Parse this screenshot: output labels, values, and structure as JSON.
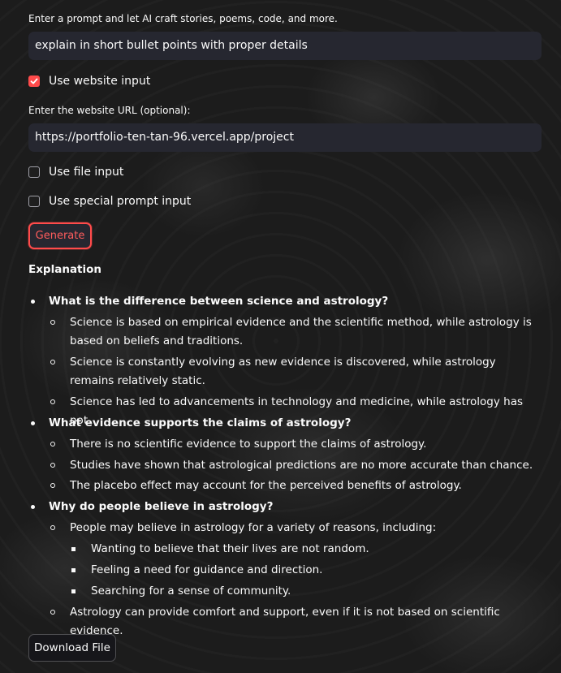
{
  "prompt": {
    "label": "Enter a prompt and let AI craft stories, poems, code, and more.",
    "value": "explain in short bullet points with proper details"
  },
  "website_checkbox": {
    "label": "Use website input",
    "checked": true
  },
  "url": {
    "label": "Enter the website URL (optional):",
    "value": "https://portfolio-ten-tan-96.vercel.app/project"
  },
  "file_checkbox": {
    "label": "Use file input",
    "checked": false
  },
  "special_checkbox": {
    "label": "Use special prompt input",
    "checked": false
  },
  "generate_label": "Generate",
  "explanation": {
    "title": "Explanation",
    "sections": [
      {
        "heading": "What is the difference between science and astrology?",
        "points": [
          "Science is based on empirical evidence and the scientific method, while astrology is based on beliefs and traditions.",
          "Science is constantly evolving as new evidence is discovered, while astrology remains relatively static.",
          "Science has led to advancements in technology and medicine, while astrology has not."
        ]
      },
      {
        "heading": "What evidence supports the claims of astrology?",
        "points": [
          "There is no scientific evidence to support the claims of astrology.",
          "Studies have shown that astrological predictions are no more accurate than chance.",
          "The placebo effect may account for the perceived benefits of astrology."
        ]
      },
      {
        "heading": "Why do people believe in astrology?",
        "points": [
          "People may believe in astrology for a variety of reasons, including:",
          "Astrology can provide comfort and support, even if it is not based on scientific evidence."
        ],
        "subpoints": [
          "Wanting to believe that their lives are not random.",
          "Feeling a need for guidance and direction.",
          "Searching for a sense of community."
        ]
      }
    ]
  },
  "download_label": "Download File",
  "colors": {
    "accent": "#ff4b4b",
    "input_bg": "#262730",
    "text": "#fafafa"
  }
}
